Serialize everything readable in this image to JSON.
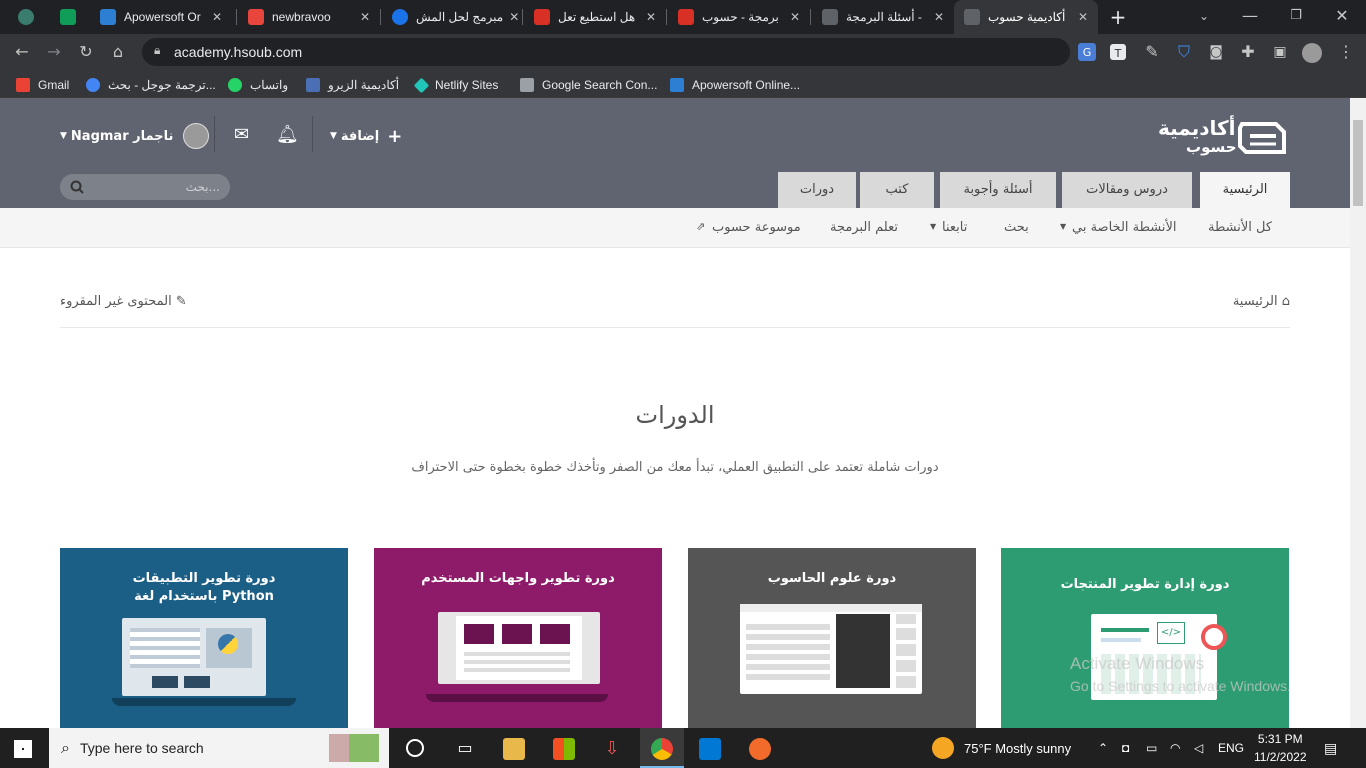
{
  "browser": {
    "tabs": [
      {
        "label": "",
        "color": "#3a7d6f"
      },
      {
        "label": "",
        "color": "#0f9d58"
      },
      {
        "label": "Apowersoft Or",
        "color": "#2d7fd3"
      },
      {
        "label": "newbravoo",
        "color": "#e8453c"
      },
      {
        "label": "مبرمج لحل المش",
        "color": "#1a73e8"
      },
      {
        "label": "هل استطيع تعل",
        "color": "#d93025"
      },
      {
        "label": "برمجة - حسوب",
        "color": "#d93025"
      },
      {
        "label": "أسئلة البرمجة -",
        "color": "#5f6368"
      },
      {
        "label": "أكاديمية حسوب",
        "color": "#5f6368"
      }
    ],
    "url": "academy.hsoub.com",
    "bookmarks": [
      {
        "label": "Gmail",
        "color": "#ea4335"
      },
      {
        "label": "ترجمة جوجل - بحث...",
        "color": "#4285f4"
      },
      {
        "label": "واتساب",
        "color": "#25d366"
      },
      {
        "label": "أكاديمية الزيرو",
        "color": "#4a6fb5"
      },
      {
        "label": "Netlify Sites",
        "color": "#20c6b7"
      },
      {
        "label": "Google Search Con...",
        "color": "#9aa0a6"
      },
      {
        "label": "Apowersoft Online...",
        "color": "#2d7fd3"
      }
    ]
  },
  "site": {
    "logo_line1": "أكاديمية",
    "logo_line2": "حسوب",
    "user_name": "Nagmar ناجمار",
    "add_label": "إضافة",
    "search_placeholder": "بحث...",
    "main_tabs": [
      "الرئيسية",
      "دروس ومقالات",
      "أسئلة وأجوبة",
      "كتب",
      "دورات"
    ],
    "subnav": [
      "كل الأنشطة",
      "الأنشطة الخاصة بي",
      "بحث",
      "تابعنا",
      "تعلم البرمجة",
      "موسوعة حسوب"
    ],
    "breadcrumb_home": "الرئيسية",
    "unread_label": "المحتوى غير المقروء",
    "section_title": "الدورات",
    "section_subtitle": "دورات شاملة تعتمد على التطبيق العملي، تبدأ معك من الصفر وتأخذك خطوة بخطوة حتى الاحتراف",
    "courses": [
      {
        "title": "دورة إدارة تطوير المنتجات",
        "color": "#2e9c73"
      },
      {
        "title": "دورة علوم الحاسوب",
        "color": "#555555"
      },
      {
        "title": "دورة تطوير واجهات المستخدم",
        "color": "#8e1b6a"
      },
      {
        "title_line1": "دورة تطوير التطبيقات",
        "title_line2": "باستخدام لغة Python",
        "color": "#1c5f86"
      }
    ]
  },
  "watermark": {
    "line1": "Activate Windows",
    "line2": "Go to Settings to activate Windows."
  },
  "taskbar": {
    "search_placeholder": "Type here to search",
    "weather": "75°F  Mostly sunny",
    "lang": "ENG",
    "time": "5:31 PM",
    "date": "11/2/2022"
  }
}
